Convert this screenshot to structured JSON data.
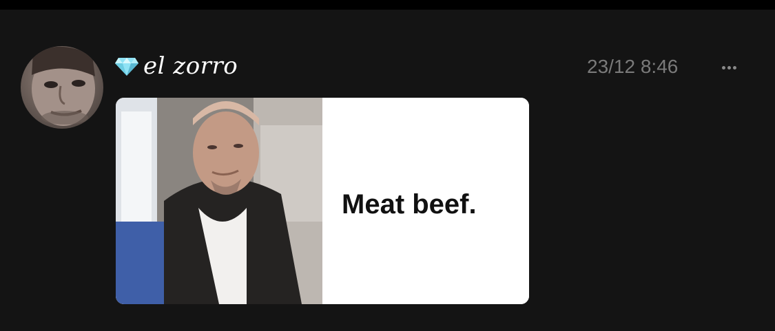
{
  "post": {
    "username": "el zorro",
    "timestamp": "23/12 8:46",
    "badge_icon": "diamond-icon",
    "more_icon": "more-options-icon",
    "media": {
      "caption_text": "Meat beef."
    }
  },
  "colors": {
    "background": "#141414",
    "username": "#ffffff",
    "timestamp": "#7a7a7a",
    "diamond": "#8fe3f5"
  }
}
